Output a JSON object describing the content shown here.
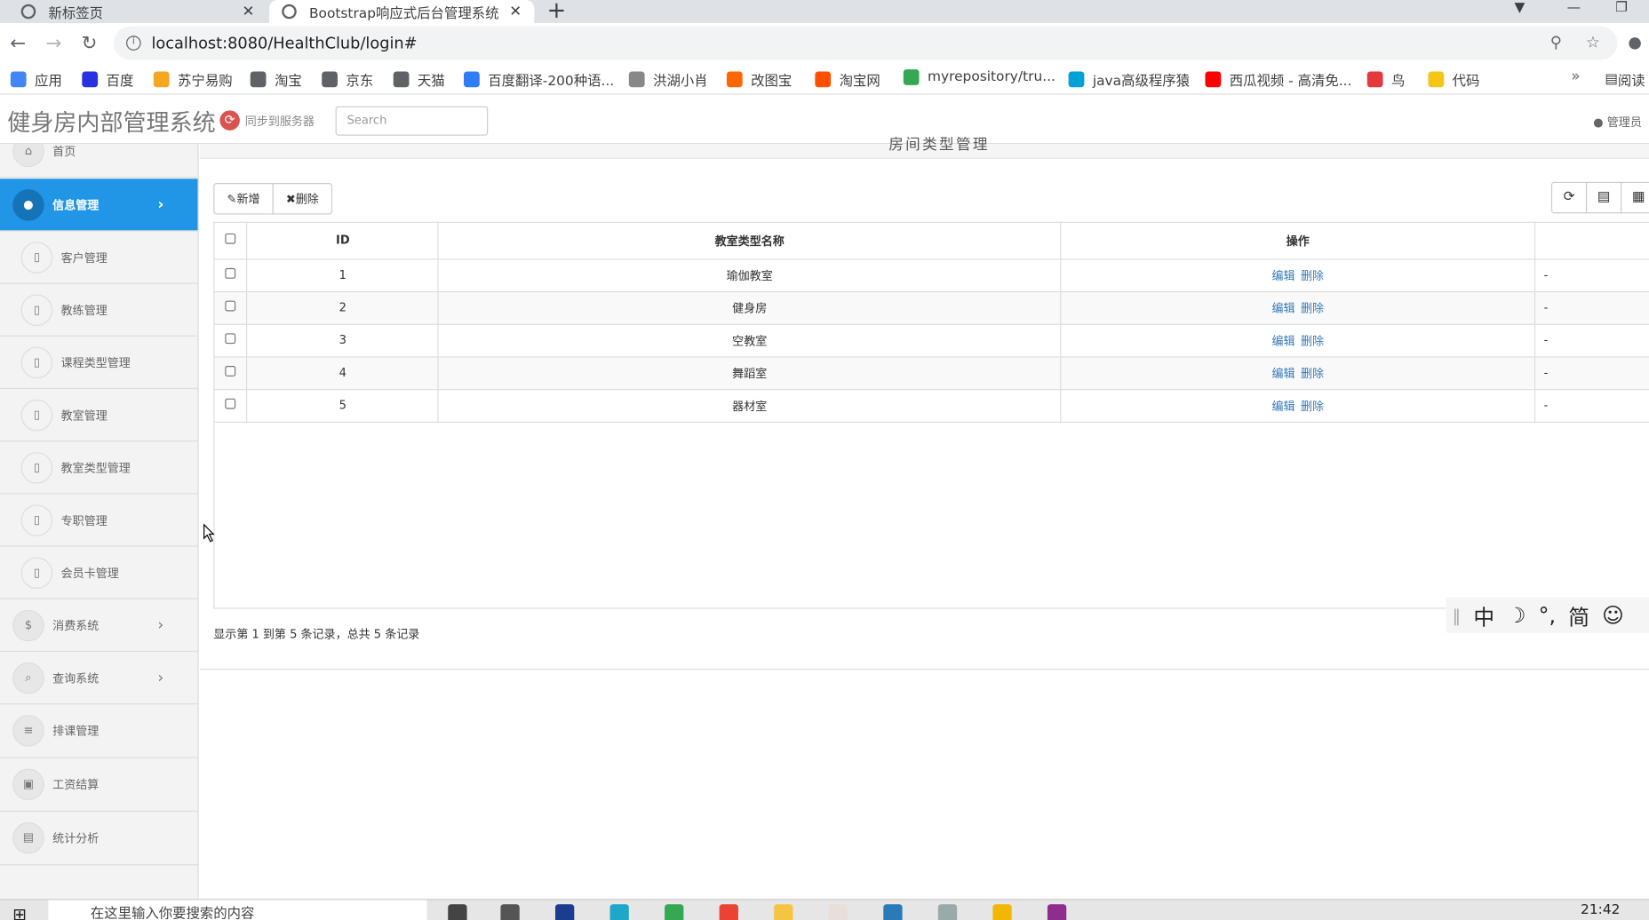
{
  "browser": {
    "tabs": [
      {
        "title": "新标签页"
      },
      {
        "title": "Bootstrap响应式后台管理系统"
      }
    ],
    "url": "localhost:8080/HealthClub/login#",
    "bookmarks": [
      {
        "label": "应用",
        "color": "#4285f4"
      },
      {
        "label": "百度",
        "color": "#2932e1"
      },
      {
        "label": "苏宁易购",
        "color": "#f5a623"
      },
      {
        "label": "淘宝",
        "color": "#5f6368"
      },
      {
        "label": "京东",
        "color": "#5f6368"
      },
      {
        "label": "天猫",
        "color": "#5f6368"
      },
      {
        "label": "百度翻译-200种语...",
        "color": "#2f7cf6"
      },
      {
        "label": "洪湖小肖",
        "color": "#888888"
      },
      {
        "label": "改图宝",
        "color": "#ff6600"
      },
      {
        "label": "淘宝网",
        "color": "#ff5000"
      },
      {
        "label": "myrepository/tru...",
        "color": "#34a853"
      },
      {
        "label": "java高级程序猿",
        "color": "#00a1d6"
      },
      {
        "label": "西瓜视频 - 高清免...",
        "color": "#f00"
      },
      {
        "label": "鸟",
        "color": "#e4393c"
      },
      {
        "label": "代码",
        "color": "#f5c518"
      }
    ],
    "reading_list": "阅读"
  },
  "header": {
    "brand": "健身房内部管理系统",
    "sync_label": "同步到服务器",
    "search_placeholder": "Search",
    "user_label": "管理员"
  },
  "sidebar": {
    "items": [
      {
        "label": "首页",
        "icon": "home-icon",
        "glyph": "⌂"
      },
      {
        "label": "信息管理",
        "icon": "user-icon",
        "glyph": "●",
        "active": true
      },
      {
        "label": "客户管理",
        "icon": "square-icon",
        "glyph": "▯",
        "sub": true
      },
      {
        "label": "教练管理",
        "icon": "square-icon",
        "glyph": "▯",
        "sub": true
      },
      {
        "label": "课程类型管理",
        "icon": "square-icon",
        "glyph": "▯",
        "sub": true
      },
      {
        "label": "教室管理",
        "icon": "square-icon",
        "glyph": "▯",
        "sub": true
      },
      {
        "label": "教室类型管理",
        "icon": "square-icon",
        "glyph": "▯",
        "sub": true
      },
      {
        "label": "专职管理",
        "icon": "square-icon",
        "glyph": "▯",
        "sub": true
      },
      {
        "label": "会员卡管理",
        "icon": "square-icon",
        "glyph": "▯",
        "sub": true
      },
      {
        "label": "消费系统",
        "icon": "dollar-icon",
        "glyph": "$",
        "arrow": true
      },
      {
        "label": "查询系统",
        "icon": "search-icon",
        "glyph": "⌕",
        "arrow": true
      },
      {
        "label": "排课管理",
        "icon": "list-icon",
        "glyph": "≡"
      },
      {
        "label": "工资结算",
        "icon": "money-icon",
        "glyph": "▣"
      },
      {
        "label": "统计分析",
        "icon": "chart-icon",
        "glyph": "▤"
      }
    ]
  },
  "main": {
    "page_title": "房间类型管理",
    "add_label": "新增",
    "delete_label": "删除",
    "columns": [
      "ID",
      "教室类型名称",
      "操作"
    ],
    "rows": [
      {
        "id": "1",
        "name": "瑜伽教室",
        "edit": "编辑",
        "del": "删除",
        "extra": "-"
      },
      {
        "id": "2",
        "name": "健身房",
        "edit": "编辑",
        "del": "删除",
        "extra": "-"
      },
      {
        "id": "3",
        "name": "空教室",
        "edit": "编辑",
        "del": "删除",
        "extra": "-"
      },
      {
        "id": "4",
        "name": "舞蹈室",
        "edit": "编辑",
        "del": "删除",
        "extra": "-"
      },
      {
        "id": "5",
        "name": "器材室",
        "edit": "编辑",
        "del": "删除",
        "extra": "-"
      }
    ],
    "pager_text": "显示第 1 到第 5 条记录，总共 5 条记录"
  },
  "ime": {
    "chars": [
      "中",
      "☽",
      "°,",
      "简",
      "☺"
    ]
  },
  "taskbar": {
    "search_placeholder": "在这里输入你要搜索的内容",
    "clock": "21:42"
  }
}
